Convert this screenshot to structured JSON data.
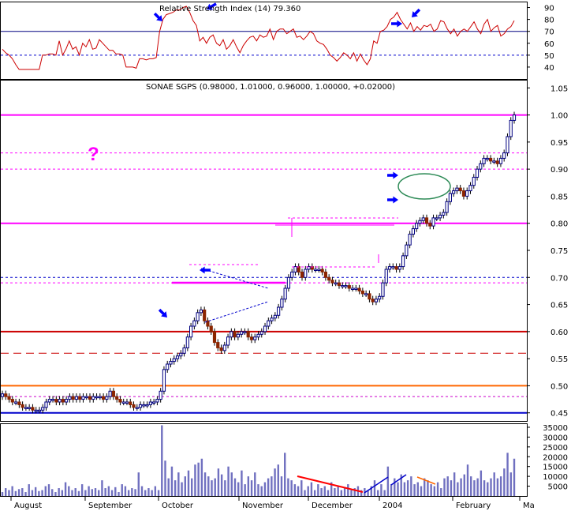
{
  "chart_data": [
    {
      "panel": "rsi",
      "type": "line",
      "title": "Relative Strength Index (14) 79.360",
      "ylim": [
        30,
        95
      ],
      "yticks": [
        40,
        50,
        60,
        70,
        80,
        90
      ],
      "levels": [
        70,
        50
      ],
      "series": [
        {
          "values": [
            55,
            52,
            50,
            47,
            42,
            38,
            38,
            38,
            38,
            38,
            38,
            38,
            50,
            50,
            51,
            51,
            50,
            62,
            50,
            55,
            62,
            55,
            57,
            50,
            60,
            57,
            63,
            55,
            56,
            63,
            60,
            57,
            54,
            54,
            51,
            51,
            50,
            40,
            40,
            40,
            39,
            47,
            47,
            46,
            47,
            47,
            48,
            70,
            80,
            84,
            85,
            86,
            88,
            88,
            90,
            91,
            86,
            79,
            75,
            62,
            65,
            60,
            65,
            67,
            60,
            58,
            63,
            55,
            58,
            63,
            57,
            52,
            58,
            62,
            65,
            66,
            62,
            67,
            65,
            66,
            72,
            63,
            70,
            72,
            72,
            68,
            70,
            72,
            65,
            66,
            63,
            66,
            70,
            68,
            62,
            60,
            59,
            55,
            50,
            48,
            45,
            48,
            52,
            50,
            47,
            52,
            45,
            51,
            46,
            42,
            47,
            62,
            60,
            70,
            71,
            74,
            80,
            82,
            86,
            80,
            76,
            72,
            77,
            70,
            74,
            71,
            75,
            74,
            76,
            70,
            72,
            79,
            78,
            72,
            68,
            72,
            66,
            70,
            72,
            70,
            74,
            78,
            72,
            68,
            76,
            80,
            70,
            73,
            75,
            66,
            68,
            72,
            74,
            79
          ]
        }
      ]
    },
    {
      "panel": "price",
      "type": "bar",
      "title": "SONAE SGPS (0.98000, 1.01000, 0.96000, 1.00000, +0.02000)",
      "ylim": [
        0.435,
        1.065
      ],
      "yticks": [
        "0.45",
        "0.50",
        "0.55",
        "0.60",
        "0.65",
        "0.70",
        "0.75",
        "0.80",
        "0.85",
        "0.90",
        "0.95",
        "1.00",
        "1.05"
      ],
      "close": [
        0.485,
        0.48,
        0.475,
        0.47,
        0.47,
        0.465,
        0.46,
        0.46,
        0.46,
        0.455,
        0.455,
        0.455,
        0.46,
        0.47,
        0.475,
        0.475,
        0.47,
        0.475,
        0.47,
        0.475,
        0.48,
        0.475,
        0.48,
        0.475,
        0.48,
        0.48,
        0.475,
        0.48,
        0.48,
        0.48,
        0.475,
        0.48,
        0.49,
        0.48,
        0.475,
        0.47,
        0.47,
        0.47,
        0.465,
        0.46,
        0.46,
        0.465,
        0.465,
        0.465,
        0.47,
        0.47,
        0.475,
        0.49,
        0.53,
        0.54,
        0.545,
        0.55,
        0.555,
        0.56,
        0.57,
        0.59,
        0.61,
        0.62,
        0.635,
        0.64,
        0.62,
        0.61,
        0.6,
        0.58,
        0.57,
        0.565,
        0.575,
        0.59,
        0.6,
        0.59,
        0.595,
        0.6,
        0.6,
        0.59,
        0.585,
        0.59,
        0.595,
        0.6,
        0.61,
        0.62,
        0.625,
        0.63,
        0.645,
        0.66,
        0.68,
        0.7,
        0.71,
        0.72,
        0.71,
        0.7,
        0.715,
        0.72,
        0.715,
        0.715,
        0.715,
        0.71,
        0.7,
        0.695,
        0.69,
        0.69,
        0.685,
        0.685,
        0.685,
        0.68,
        0.68,
        0.68,
        0.675,
        0.67,
        0.67,
        0.66,
        0.655,
        0.66,
        0.665,
        0.69,
        0.715,
        0.72,
        0.72,
        0.715,
        0.72,
        0.74,
        0.76,
        0.78,
        0.79,
        0.8,
        0.805,
        0.81,
        0.8,
        0.795,
        0.81,
        0.81,
        0.815,
        0.82,
        0.84,
        0.855,
        0.86,
        0.865,
        0.86,
        0.85,
        0.86,
        0.87,
        0.885,
        0.9,
        0.91,
        0.92,
        0.92,
        0.915,
        0.915,
        0.91,
        0.92,
        0.93,
        0.96,
        0.99,
        1.0
      ],
      "levels": [
        {
          "value": 1.0,
          "color": "#ff00ff",
          "style": "solid"
        },
        {
          "value": 0.93,
          "color": "#ff00ff",
          "style": "dashed"
        },
        {
          "value": 0.9,
          "color": "#ff00ff",
          "style": "dashed"
        },
        {
          "value": 0.8,
          "color": "#ff00ff",
          "style": "solid"
        },
        {
          "value": 0.7,
          "color": "#0000cc",
          "style": "dashed"
        },
        {
          "value": 0.69,
          "color": "#ff00ff",
          "style": "dashed"
        },
        {
          "value": 0.6,
          "color": "#cc0000",
          "style": "solid"
        },
        {
          "value": 0.56,
          "color": "#cc0000",
          "style": "longdash"
        },
        {
          "value": 0.5,
          "color": "#ff6600",
          "style": "solid"
        },
        {
          "value": 0.48,
          "color": "#cc00cc",
          "style": "dashed"
        },
        {
          "value": 0.45,
          "color": "#0000cc",
          "style": "solid"
        }
      ],
      "annotation": "?"
    },
    {
      "panel": "volume",
      "type": "bar",
      "ylim": [
        0,
        37000
      ],
      "yticks": [
        "5000",
        "10000",
        "15000",
        "20000",
        "25000",
        "30000",
        "35000"
      ],
      "values": [
        2000,
        4000,
        3000,
        5000,
        2500,
        3500,
        4000,
        2000,
        6000,
        3000,
        4500,
        2500,
        3000,
        5000,
        6000,
        3500,
        2000,
        4000,
        3000,
        7000,
        5000,
        3000,
        4000,
        2500,
        6000,
        3000,
        5000,
        3500,
        4000,
        3000,
        8000,
        4000,
        5000,
        3000,
        4500,
        2000,
        6000,
        5000,
        3000,
        4000,
        3500,
        12000,
        5000,
        3000,
        4000,
        3000,
        5000,
        3000,
        36000,
        18000,
        9000,
        15000,
        8000,
        12000,
        7000,
        10000,
        13000,
        9000,
        16000,
        17000,
        19000,
        12000,
        10000,
        8000,
        9000,
        14000,
        11000,
        8000,
        15000,
        12000,
        9000,
        7000,
        13000,
        6000,
        10000,
        8000,
        12000,
        6000,
        5000,
        7000,
        9000,
        10000,
        14000,
        16000,
        10000,
        22000,
        9000,
        8000,
        6000,
        5000,
        8000,
        3000,
        5000,
        7000,
        3000,
        6000,
        4000,
        5000,
        3000,
        7000,
        4000,
        5000,
        3000,
        4000,
        6000,
        3000,
        4000,
        5000,
        3000,
        4000,
        3000,
        5000,
        8000,
        3000,
        6000,
        3000,
        15000,
        6000,
        9000,
        7000,
        11000,
        7000,
        8000,
        10000,
        6000,
        7000,
        5000,
        9000,
        8000,
        6000,
        5000,
        7000,
        4000,
        9000,
        10000,
        8000,
        12000,
        7000,
        9000,
        11000,
        16000,
        10000,
        8000,
        9000,
        13000,
        8000,
        7000,
        9000,
        12000,
        9000,
        10000,
        14000,
        22000,
        12000,
        19000
      ],
      "x_tick_labels": [
        "August",
        "September",
        "October",
        "November",
        "December",
        "2004",
        "February",
        "Ma"
      ]
    }
  ],
  "colors": {
    "rsi_line": "#cc0000",
    "up_bar": "#000080",
    "down_bar": "#8b2500",
    "volume": "#7070c0",
    "arrows": "#0000ff",
    "circle": "#2e8b57"
  }
}
